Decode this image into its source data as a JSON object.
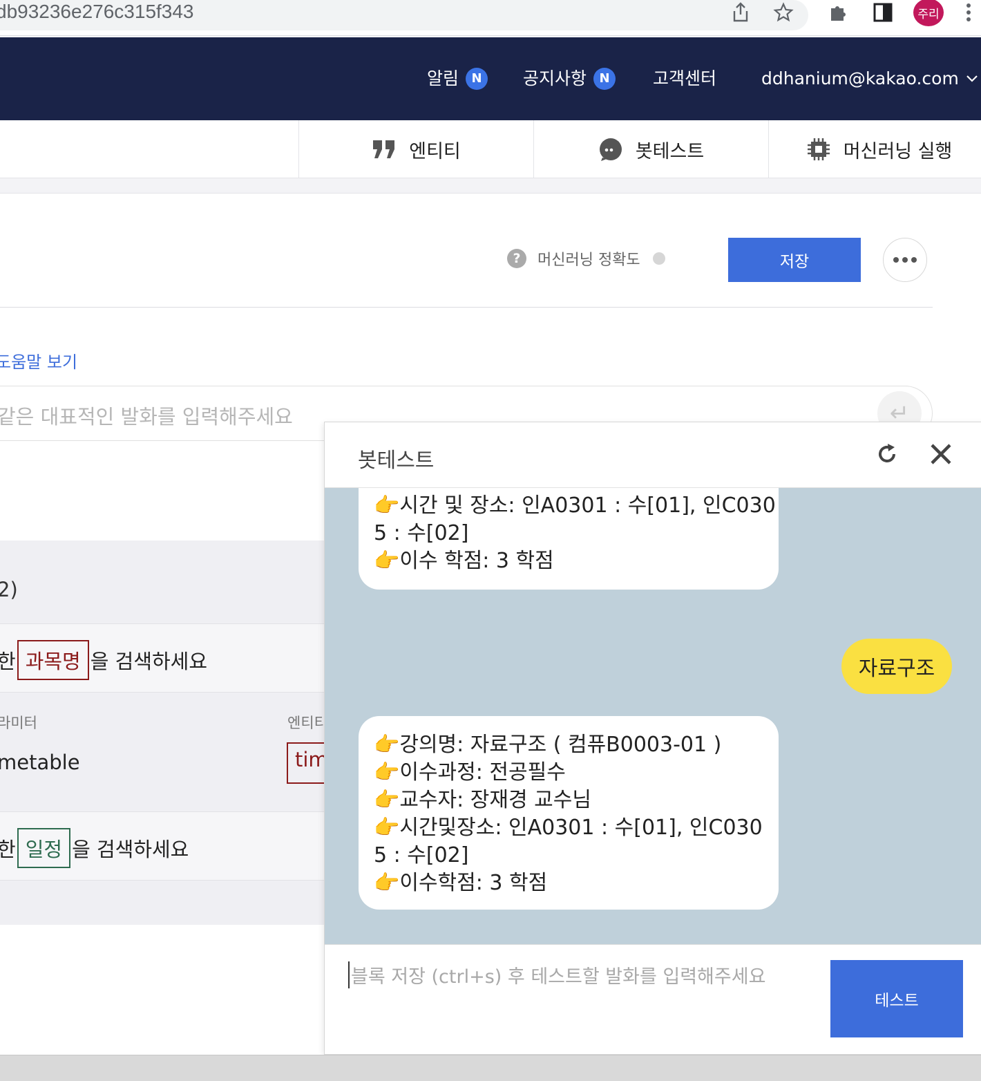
{
  "browser": {
    "url_fragment": "db93236e276c315f343",
    "profile_initials": "주리"
  },
  "topnav": {
    "alerts_label": "알림",
    "alerts_badge": "N",
    "notice_label": "공지사항",
    "notice_badge": "N",
    "support_label": "고객센터",
    "account_email": "ddhanium@kakao.com"
  },
  "tabs": [
    {
      "label": "엔티티",
      "icon": "quote-icon"
    },
    {
      "label": "봇테스트",
      "icon": "chat-bubble-icon"
    },
    {
      "label": "머신러닝 실행",
      "icon": "chip-icon"
    }
  ],
  "toolbar": {
    "ml_accuracy_label": "머신러닝 정확도",
    "save_label": "저장"
  },
  "editor": {
    "help_link": "도움말 보기",
    "utterance_placeholder": "같은 대표적인 발화를 입력해주세요",
    "count_fragment": "2)",
    "pattern1_prefix": "한",
    "pattern1_entity": "과목명",
    "pattern1_suffix": "을 검색하세요",
    "param_header": "라미터",
    "entity_header": "엔티티",
    "param_value": "metable",
    "entity_value_fragment": "tim",
    "pattern2_prefix": "한",
    "pattern2_entity": "일정",
    "pattern2_suffix": "을 검색하세요"
  },
  "bottest": {
    "title": "봇테스트",
    "messages": [
      {
        "from": "bot",
        "lines": [
          "👉시간 및 장소: 인A0301 : 수[01], 인C030",
          "5 : 수[02]",
          "👉이수 학점: 3 학점"
        ]
      },
      {
        "from": "user",
        "text": "자료구조"
      },
      {
        "from": "bot",
        "lines": [
          "👉강의명: 자료구조 ( 컴퓨B0003-01 )",
          "👉이수과정: 전공필수",
          "👉교수자: 장재경 교수님",
          "👉시간및장소: 인A0301 : 수[01], 인C030",
          "5 : 수[02]",
          "👉이수학점: 3 학점"
        ]
      }
    ],
    "input_placeholder": "블록 저장 (ctrl+s) 후 테스트할 발화를 입력해주세요",
    "test_button": "테스트"
  },
  "colors": {
    "nav_bg": "#1a2348",
    "accent_blue": "#3d6ddb",
    "chat_bg": "#bfd0da",
    "user_bubble": "#fae041",
    "entity_red": "#8b1a1a",
    "entity_green": "#2e6b4f"
  }
}
